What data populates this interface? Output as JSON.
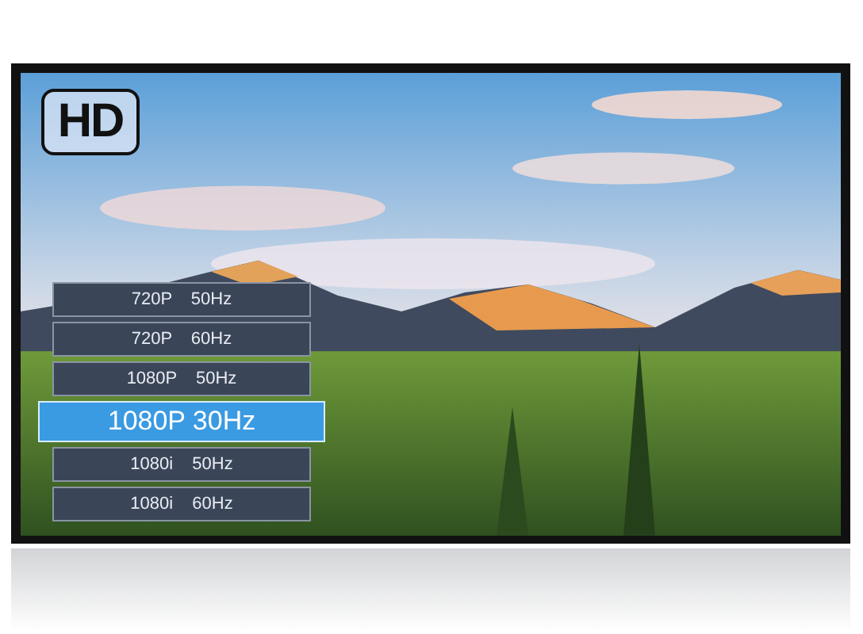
{
  "badge": {
    "text": "HD"
  },
  "resolution_menu": {
    "items": [
      {
        "label": "720P 50Hz",
        "selected": false
      },
      {
        "label": "720P 60Hz",
        "selected": false
      },
      {
        "label": "1080P 50Hz",
        "selected": false
      },
      {
        "label": "1080P 30Hz",
        "selected": true
      },
      {
        "label": "1080i 50Hz",
        "selected": false
      },
      {
        "label": "1080i 60Hz",
        "selected": false
      }
    ]
  }
}
